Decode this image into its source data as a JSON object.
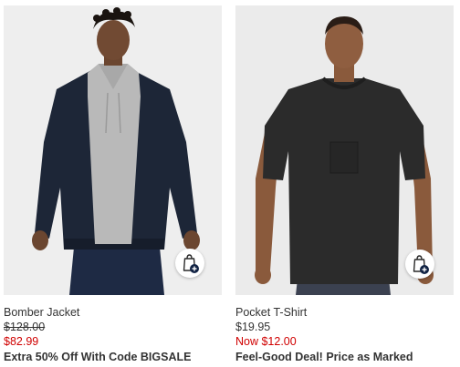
{
  "products": [
    {
      "name": "Bomber Jacket",
      "original_price": "$128.00",
      "sale_price": "$82.99",
      "promo": "Extra 50% Off With Code BIGSALE",
      "image_icon": "bomber-jacket-model-photo"
    },
    {
      "name": "Pocket T-Shirt",
      "original_price": "$19.95",
      "sale_price": "Now $12.00",
      "promo": "Feel-Good Deal! Price as Marked",
      "image_icon": "pocket-tshirt-model-photo"
    }
  ],
  "colors": {
    "sale": "#d00000",
    "text": "#333333",
    "photo_bg": "#eeeeee",
    "badge": "#122344"
  },
  "icons": {
    "quick_add": "shopping-bag-plus-icon"
  }
}
